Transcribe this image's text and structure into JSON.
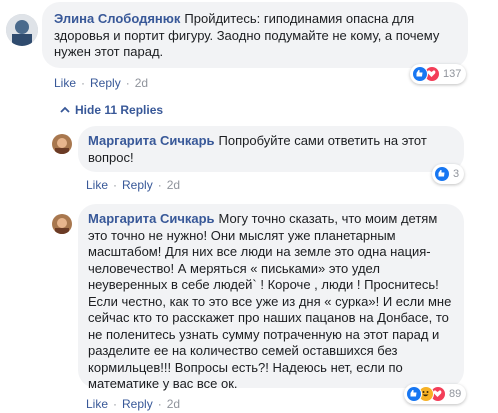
{
  "comments": [
    {
      "author": "Элина Слободянюк",
      "text": "Пройдитесь: гиподинамия опасна для здоровья и портит фигуру. Заодно подумайте не кому, а почему нужен этот парад.",
      "like": "Like",
      "reply": "Reply",
      "time": "2d",
      "reactions": [
        "like",
        "love"
      ],
      "reaction_count": "137"
    }
  ],
  "hide_replies": "Hide 11 Replies",
  "replies": [
    {
      "author": "Маргарита Сичкарь",
      "text": "Попробуйте сами ответить на этот вопрос!",
      "like": "Like",
      "reply": "Reply",
      "time": "2d",
      "reactions": [
        "like"
      ],
      "reaction_count": "3"
    },
    {
      "author": "Маргарита Сичкарь",
      "text": "Могу точно сказать, что моим детям это точно не нужно! Они мыслят уже планетарным масштабом! Для них все люди на земле это одна нация-человечество! А меряться « письками» это удел неуверенных в себе людей` ! Короче , люди ! Проснитесь! Если честно, как то это все уже из дня « сурка»! И если мне сейчас кто то расскажет про наших пацанов на Донбасе, то не поленитесь узнать сумму потраченную на этот парад и разделите ее на количество семей оставшихся без кормильцев!!! Вопросы есть?! Надеюсь нет, если по математике у вас все ок.",
      "like": "Like",
      "reply": "Reply",
      "time": "2d",
      "reactions": [
        "like",
        "haha",
        "love"
      ],
      "reaction_count": "89"
    }
  ],
  "colors": {
    "link": "#385898",
    "bubble": "#f2f3f5",
    "meta": "#90949c",
    "like": "#1877f2",
    "love": "#f33e58",
    "haha": "#f7b125"
  }
}
